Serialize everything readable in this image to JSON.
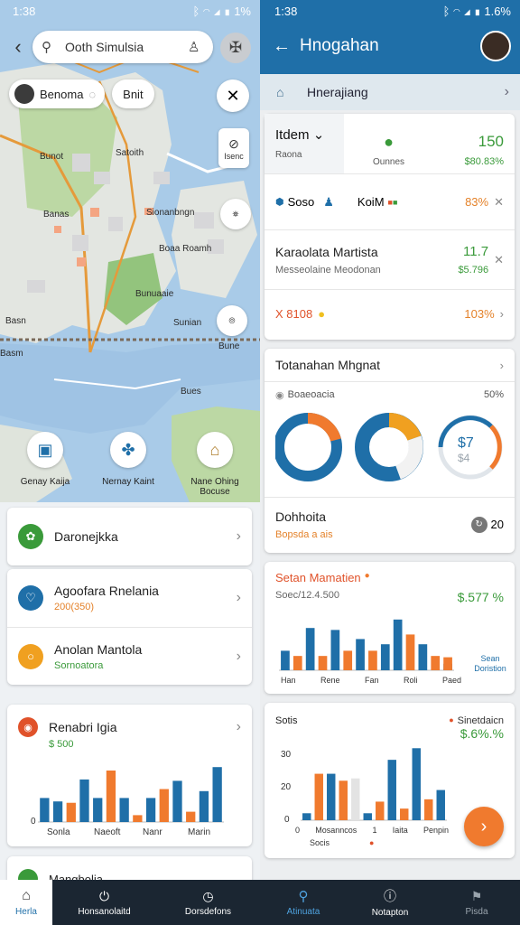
{
  "left_pane": {
    "status": {
      "time": "1:38",
      "battery": "1%"
    },
    "search": {
      "placeholder": "Ooth Simulsia"
    },
    "chips": {
      "user_chip": "Benoma",
      "second_chip": "Bnit"
    },
    "side_tool_label": "Isenc",
    "map_labels": {
      "l1": "Bunot",
      "l2": "Satoith",
      "l3": "Banas",
      "l4": "Sionanbngn",
      "l5": "Boaa Roamh",
      "l6": "Bunuaaie",
      "l7": "Basn",
      "l8": "Sunian",
      "l9": "Basm",
      "l10": "Bune",
      "l11": "Bues"
    },
    "shortcuts": [
      {
        "label": "Genay Kaija",
        "icon": "bus-icon"
      },
      {
        "label": "Nernay Kaint",
        "icon": "bike-icon"
      },
      {
        "label": "Nane Ohing Bocuse",
        "icon": "briefcase-icon"
      }
    ],
    "list": [
      {
        "title": "Daronejkka",
        "subtitle": "",
        "color": "#3a9a3a"
      },
      {
        "title": "Agoofara Rnelania",
        "subtitle": "200(350)",
        "color": "#1f6fa8"
      },
      {
        "title": "Anolan Mantola",
        "subtitle": "Sornoatora",
        "color": "#f0a020"
      },
      {
        "title": "Renabri Igia",
        "subtitle": "$ 500",
        "color": "#e0522a"
      }
    ],
    "mini_chart": {
      "ytick": "0",
      "xlabels": [
        "Sonla",
        "Naeoft",
        "Nanr",
        "Marin"
      ]
    },
    "peek_title": "Mangbolia",
    "bottom_nav": [
      {
        "label": "Herla",
        "icon": "home-icon"
      },
      {
        "label": "Honsanolaitd",
        "icon": "power-icon"
      },
      {
        "label": "Dorsdefons",
        "icon": "clock-icon"
      }
    ]
  },
  "right_pane": {
    "status": {
      "time": "1:38",
      "battery": "1.6%"
    },
    "title": "Hnogahan",
    "crumb": "Hnerajiang",
    "summary": {
      "item_label": "Itdem",
      "item_sub": "Raona",
      "center_sub": "Ounnes",
      "value_main": "150",
      "value_sub": "$80.83%"
    },
    "rows": [
      {
        "left": "Soso",
        "mid": "KoiM",
        "value": "83%"
      },
      {
        "title": "Karaolata Martista",
        "sub": "Messeolaine Meodonan",
        "value_main": "11.7",
        "value_sub": "$5.796"
      },
      {
        "left": "X 8108",
        "value": "103%"
      }
    ],
    "donut_card": {
      "title": "Totanahan Mhgnat",
      "legend_left": "Boaeoacia",
      "legend_right": "50%",
      "donut_center": "$7",
      "donut_center_sub": "$4",
      "footer_title": "Dohhoita",
      "footer_sub": "Bopsda a ais",
      "footer_value": "20"
    },
    "bar_card": {
      "title": "Setan Mamatien",
      "subtitle": "Soec/12.4.500",
      "value": "$.577 %",
      "legend": "Sean Doristion",
      "xlabels": [
        "Han",
        "Rene",
        "Fan",
        "Roli",
        "Paed"
      ]
    },
    "bar_card2": {
      "title": "Sotis",
      "legend": "Sinetdaicn",
      "value": "$.6%.%",
      "yticks": [
        "30",
        "20",
        "0"
      ],
      "xlabels": [
        "0",
        "Mosanncos",
        "1",
        "Iaita",
        "Penpin"
      ],
      "foot": "Socis"
    },
    "bottom_nav": [
      {
        "label": "Atinuata",
        "icon": "search-icon"
      },
      {
        "label": "Notapton",
        "icon": "info-icon"
      },
      {
        "label": "Pisda",
        "icon": "flag-icon"
      }
    ]
  },
  "chart_data": [
    {
      "type": "bar",
      "title": "",
      "categories": [
        "1",
        "2",
        "3",
        "4",
        "5",
        "6",
        "7",
        "8",
        "9",
        "10",
        "11",
        "12",
        "13",
        "14"
      ],
      "series": [
        {
          "values": [
            35,
            30,
            0,
            62,
            35,
            0,
            35,
            0,
            35,
            0,
            60,
            0,
            45,
            80
          ],
          "color": "#1f6fa8"
        },
        {
          "values": [
            0,
            0,
            28,
            0,
            0,
            75,
            0,
            10,
            0,
            48,
            0,
            15,
            0,
            0
          ],
          "color": "#f07a2e"
        }
      ],
      "ylim": [
        0,
        100
      ]
    },
    {
      "type": "bar",
      "title": "Setan Mamatien",
      "categories": [
        "1",
        "2",
        "3",
        "4",
        "5",
        "6",
        "7",
        "8",
        "9",
        "10",
        "11",
        "12",
        "13",
        "14"
      ],
      "series": [
        {
          "values": [
            30,
            0,
            65,
            0,
            62,
            0,
            48,
            0,
            40,
            78,
            0,
            40,
            0,
            10
          ],
          "color": "#1f6fa8"
        },
        {
          "values": [
            0,
            22,
            0,
            22,
            0,
            30,
            0,
            30,
            0,
            0,
            55,
            0,
            22,
            20
          ],
          "color": "#f07a2e"
        }
      ],
      "ylim": [
        0,
        100
      ]
    },
    {
      "type": "bar",
      "title": "Sotis",
      "categories": [
        "1",
        "2",
        "3",
        "4",
        "5",
        "6",
        "7",
        "8",
        "9",
        "10",
        "11",
        "12"
      ],
      "series": [
        {
          "values": [
            3,
            0,
            20,
            0,
            0,
            3,
            0,
            26,
            0,
            31,
            0,
            13
          ],
          "color": "#1f6fa8"
        },
        {
          "values": [
            0,
            20,
            0,
            17,
            0,
            0,
            8,
            0,
            5,
            0,
            9,
            0
          ],
          "color": "#f07a2e"
        },
        {
          "values": [
            0,
            0,
            0,
            0,
            18,
            0,
            0,
            0,
            0,
            0,
            0,
            0
          ],
          "color": "#e3e3e3"
        }
      ],
      "yticks": [
        0,
        20,
        30
      ],
      "ylim": [
        0,
        35
      ]
    }
  ]
}
